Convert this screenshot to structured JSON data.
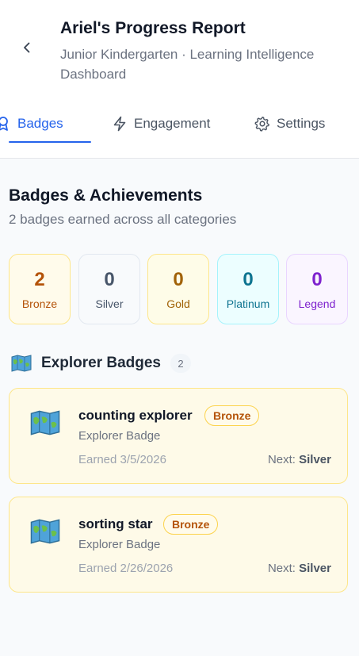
{
  "header": {
    "title": "Ariel's Progress Report",
    "subtitle": "Junior Kindergarten · Learning Intelligence Dashboard"
  },
  "tabs": [
    {
      "label": "Badges",
      "icon": "badge-icon",
      "active": true
    },
    {
      "label": "Engagement",
      "icon": "lightning-icon",
      "active": false
    },
    {
      "label": "Settings",
      "icon": "gear-icon",
      "active": false
    }
  ],
  "section": {
    "title": "Badges & Achievements",
    "subtitle": "2 badges earned across all categories"
  },
  "tiers": [
    {
      "count": "2",
      "label": "Bronze"
    },
    {
      "count": "0",
      "label": "Silver"
    },
    {
      "count": "0",
      "label": "Gold"
    },
    {
      "count": "0",
      "label": "Platinum"
    },
    {
      "count": "0",
      "label": "Legend"
    }
  ],
  "category": {
    "icon": "world-map-icon",
    "title": "Explorer Badges",
    "count": "2"
  },
  "badges": [
    {
      "icon": "world-map-icon",
      "name": "counting explorer",
      "tier": "Bronze",
      "type": "Explorer Badge",
      "earned": "Earned 3/5/2026",
      "next_prefix": "Next:",
      "next_tier": "Silver"
    },
    {
      "icon": "world-map-icon",
      "name": "sorting star",
      "tier": "Bronze",
      "type": "Explorer Badge",
      "earned": "Earned 2/26/2026",
      "next_prefix": "Next:",
      "next_tier": "Silver"
    }
  ],
  "colors": {
    "accent": "#2563eb",
    "bronze": "#b45309",
    "silver": "#475569",
    "gold": "#a16207",
    "platinum": "#0e7490",
    "legend": "#7e22ce",
    "card_bg": "#fefae8",
    "card_border": "#fde68a"
  }
}
